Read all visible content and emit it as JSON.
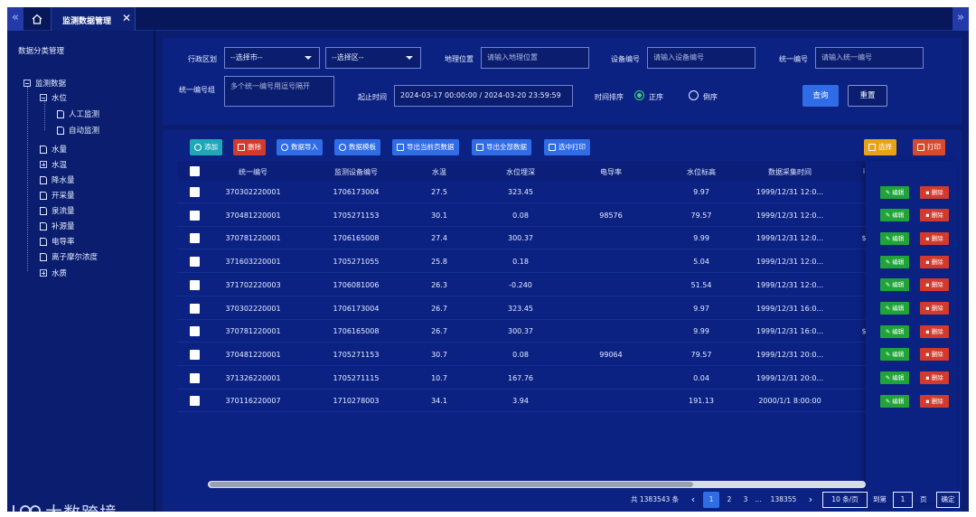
{
  "topbar": {
    "left_arrow": "«",
    "right_arrow": "»",
    "tab_title": "监测数据管理",
    "tab_close": "✕"
  },
  "sidebar": {
    "title": "数据分类管理",
    "tree": {
      "root": "监测数据",
      "water_level": "水位",
      "manual": "人工监测",
      "auto": "自动监测",
      "items": [
        "水量",
        "水温",
        "降水量",
        "开采量",
        "泉流量",
        "补源量",
        "电导率",
        "离子摩尔浓度",
        "水质"
      ]
    },
    "logo_text": "大数跨境"
  },
  "filters": {
    "region_label": "行政区划",
    "city_select": "--选择市--",
    "district_select": "--选择区--",
    "location_label": "地理位置",
    "location_placeholder": "请输入地理位置",
    "device_label": "设备编号",
    "device_placeholder": "请输入设备编号",
    "unified_label": "统一编号",
    "unified_placeholder": "请输入统一编号",
    "unified_group_label": "统一编号组",
    "unified_group_placeholder": "多个统一编号用逗号隔开",
    "time_label": "起止时间",
    "time_value": "2024-03-17 00:00:00 / 2024-03-20 23:59:59",
    "sort_label": "时间排序",
    "sort_asc": "正序",
    "sort_desc": "倒序",
    "query_button": "查询",
    "reset_button": "重置"
  },
  "toolbar": {
    "add": "添加",
    "delete": "删除",
    "import": "数据导入",
    "template": "数据模板",
    "export_page": "导出当前页数据",
    "export_all": "导出全部数据",
    "print_selected": "选中打印",
    "select": "选择",
    "print": "打印"
  },
  "table": {
    "headers": [
      "统一编号",
      "监测设备编号",
      "水温",
      "水位埋深",
      "电导率",
      "水位标高",
      "数据采集时间",
      "i"
    ],
    "rows": [
      [
        "370302220001",
        "1706173004",
        "27.5",
        "323.45",
        "",
        "9.97",
        "1999/12/31 12:0...",
        ""
      ],
      [
        "370481220001",
        "1705271153",
        "30.1",
        "0.08",
        "98576",
        "79.57",
        "1999/12/31 12:0...",
        ""
      ],
      [
        "370781220001",
        "1706165008",
        "27.4",
        "300.37",
        "",
        "9.99",
        "1999/12/31 12:0...",
        "$"
      ],
      [
        "371603220001",
        "1705271055",
        "25.8",
        "0.18",
        "",
        "5.04",
        "1999/12/31 12:0...",
        ""
      ],
      [
        "371702220003",
        "1706081006",
        "26.3",
        "-0.240",
        "",
        "51.54",
        "1999/12/31 12:0...",
        ""
      ],
      [
        "370302220001",
        "1706173004",
        "26.7",
        "323.45",
        "",
        "9.97",
        "1999/12/31 16:0...",
        ""
      ],
      [
        "370781220001",
        "1706165008",
        "26.7",
        "300.37",
        "",
        "9.99",
        "1999/12/31 16:0...",
        "$"
      ],
      [
        "370481220001",
        "1705271153",
        "30.7",
        "0.08",
        "99064",
        "79.57",
        "1999/12/31 20:0...",
        ""
      ],
      [
        "371326220001",
        "1705271115",
        "10.7",
        "167.76",
        "",
        "0.04",
        "1999/12/31 20:0...",
        ""
      ],
      [
        "370116220007",
        "1710278003",
        "34.1",
        "3.94",
        "",
        "191.13",
        "2000/1/1 8:00:00",
        ""
      ]
    ],
    "edit_label": "编辑",
    "delete_label": "删除"
  },
  "pagination": {
    "total": "共 1383543 条",
    "prev": "‹",
    "pages": [
      "1",
      "2",
      "3",
      "...",
      "138355"
    ],
    "next": "›",
    "page_size": "10 条/页",
    "goto_label": "到第",
    "goto_value": "1",
    "page_unit": "页",
    "confirm": "确定"
  },
  "colors": {
    "background": "#0a1d6e",
    "panel": "#0c2283",
    "primary": "#2f6ce6",
    "edit_green": "#20a43a",
    "delete_red": "#d23a2d"
  }
}
